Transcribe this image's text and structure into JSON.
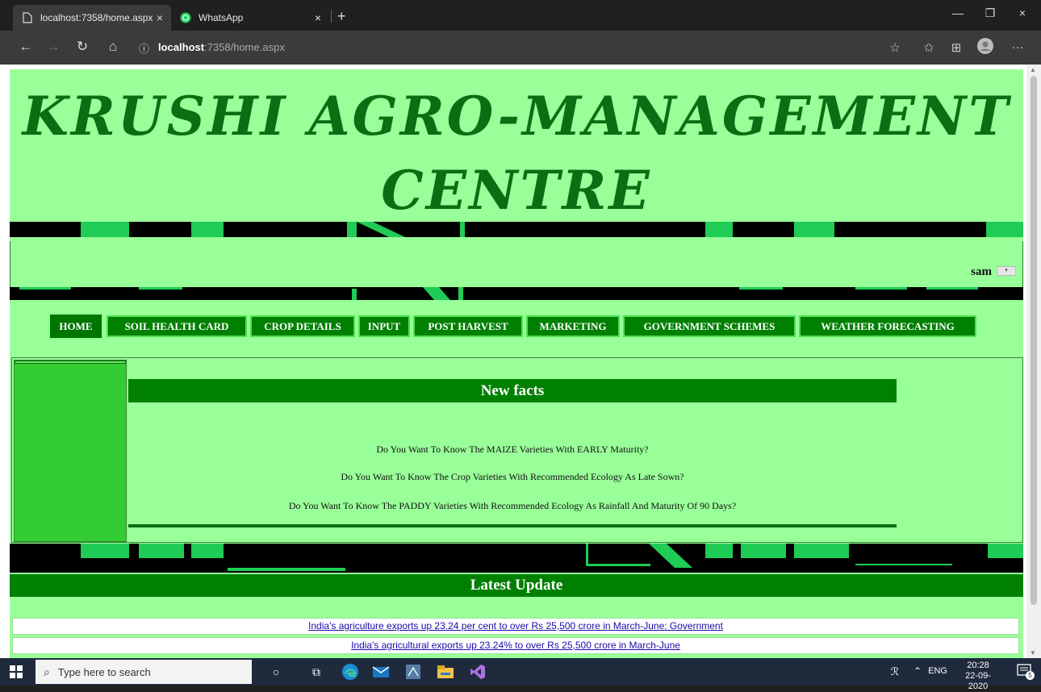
{
  "browser": {
    "tabs": [
      {
        "title": "localhost:7358/home.aspx",
        "active": true
      },
      {
        "title": "WhatsApp",
        "active": false
      }
    ],
    "new_tab_glyph": "+",
    "url_host": "localhost",
    "url_rest": ":7358/home.aspx",
    "info_glyph": "ⓘ",
    "back_glyph": "←",
    "forward_glyph": "→",
    "refresh_glyph": "↻",
    "home_glyph": "⌂",
    "more_glyph": "···",
    "close_glyph": "×",
    "minimize_glyph": "—",
    "restore_glyph": "❐"
  },
  "site": {
    "title": "KRUSHI AGRO-MANAGEMENT CENTRE",
    "username": "sam",
    "menu": [
      {
        "label": "HOME",
        "active": true
      },
      {
        "label": "SOIL HEALTH CARD"
      },
      {
        "label": "CROP DETAILS"
      },
      {
        "label": "INPUT"
      },
      {
        "label": "POST HARVEST"
      },
      {
        "label": "MARKETING"
      },
      {
        "label": "GOVERNMENT SCHEMES"
      },
      {
        "label": "WEATHER FORECASTING"
      }
    ],
    "facts_title": "New facts",
    "facts": [
      "Do You Want To Know The MAIZE Varieties With EARLY Maturity?",
      "Do You Want To Know The Crop Varieties With Recommended Ecology As Late Sown?",
      "Do You Want To Know The PADDY Varieties With Recommended Ecology As Rainfall And Maturity Of 90 Days?"
    ],
    "latest_title": "Latest Update",
    "news": [
      "India's agriculture exports up 23.24 per cent to over Rs 25,500 crore in March-June: Government",
      "India's agricultural exports up 23.24% to over Rs 25,500 crore in March-June"
    ],
    "colors": {
      "page_bg": "#99ff99",
      "title": "#0a6e12",
      "menu_bg": "#008000",
      "accent": "#1fcc55"
    }
  },
  "taskbar": {
    "search_placeholder": "Type here to search",
    "language": "ENG",
    "time": "20:28",
    "date": "22-09-2020",
    "notification_count": "5"
  }
}
